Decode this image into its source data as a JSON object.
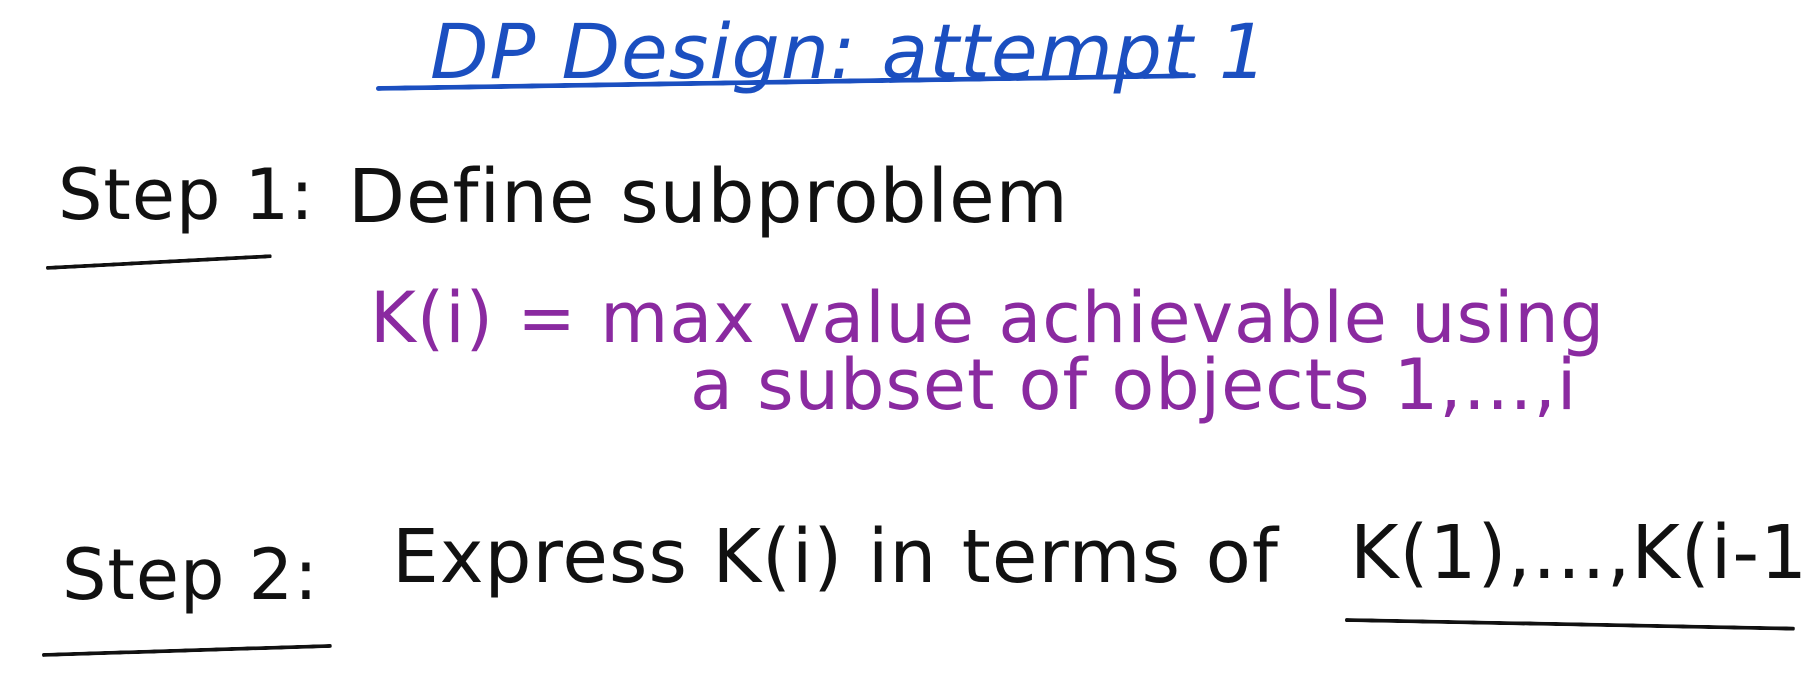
{
  "title": "DP Design: attempt 1",
  "step1": {
    "label": "Step 1:",
    "text": "Define subproblem",
    "definition_line1": "K(i) = max value achievable using",
    "definition_line2": "a subset of objects 1,…,i"
  },
  "step2": {
    "label": "Step 2:",
    "text": "Express K(i) in terms of",
    "range": "K(1),…,K(i-1)"
  },
  "colors": {
    "title_ink": "#1b4fc0",
    "body_ink": "#111111",
    "definition_ink": "#8a2aa0"
  }
}
